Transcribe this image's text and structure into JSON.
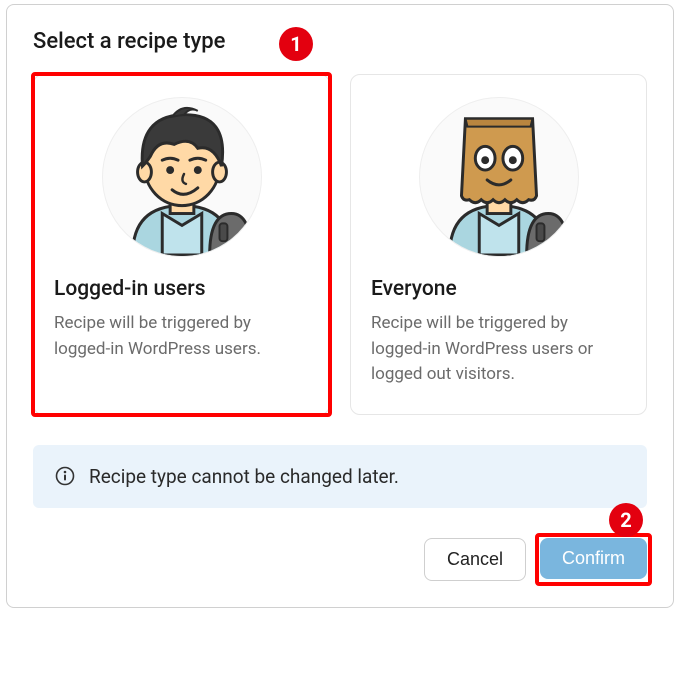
{
  "title": "Select a recipe type",
  "cards": {
    "logged_in": {
      "title": "Logged-in users",
      "desc": "Recipe will be triggered by logged-in WordPress users."
    },
    "everyone": {
      "title": "Everyone",
      "desc": "Recipe will be triggered by logged-in WordPress users or logged out visitors."
    }
  },
  "notice": "Recipe type cannot be changed later.",
  "buttons": {
    "cancel": "Cancel",
    "confirm": "Confirm"
  },
  "markers": {
    "one": "1",
    "two": "2"
  }
}
